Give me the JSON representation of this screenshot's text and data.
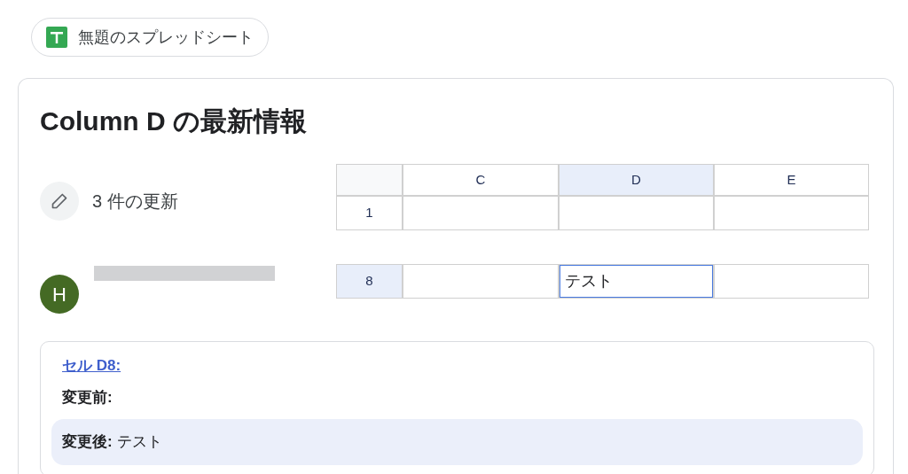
{
  "file_chip": {
    "title": "無題のスプレッドシート"
  },
  "card": {
    "title": "Column D の最新情報",
    "update_count": "3 件の更新",
    "user": {
      "avatar": "H"
    },
    "grid": {
      "columns": [
        {
          "label": "C",
          "selected": false
        },
        {
          "label": "D",
          "selected": true
        },
        {
          "label": "E",
          "selected": false
        }
      ],
      "row_blocks": [
        {
          "rows": [
            {
              "label": "1",
              "selected": false,
              "cells": [
                {
                  "selected": false
                },
                {
                  "selected": false
                },
                {
                  "selected": false
                }
              ]
            }
          ]
        },
        {
          "rows": [
            {
              "label": "8",
              "selected": true,
              "cells": [
                {
                  "selected": false
                },
                {
                  "selected": true,
                  "value": "テスト"
                },
                {
                  "selected": false
                }
              ]
            }
          ]
        }
      ]
    },
    "change": {
      "link": "セル D8:",
      "before_label": "変更前:",
      "after_label": "変更後:",
      "after_value": "テスト"
    }
  }
}
